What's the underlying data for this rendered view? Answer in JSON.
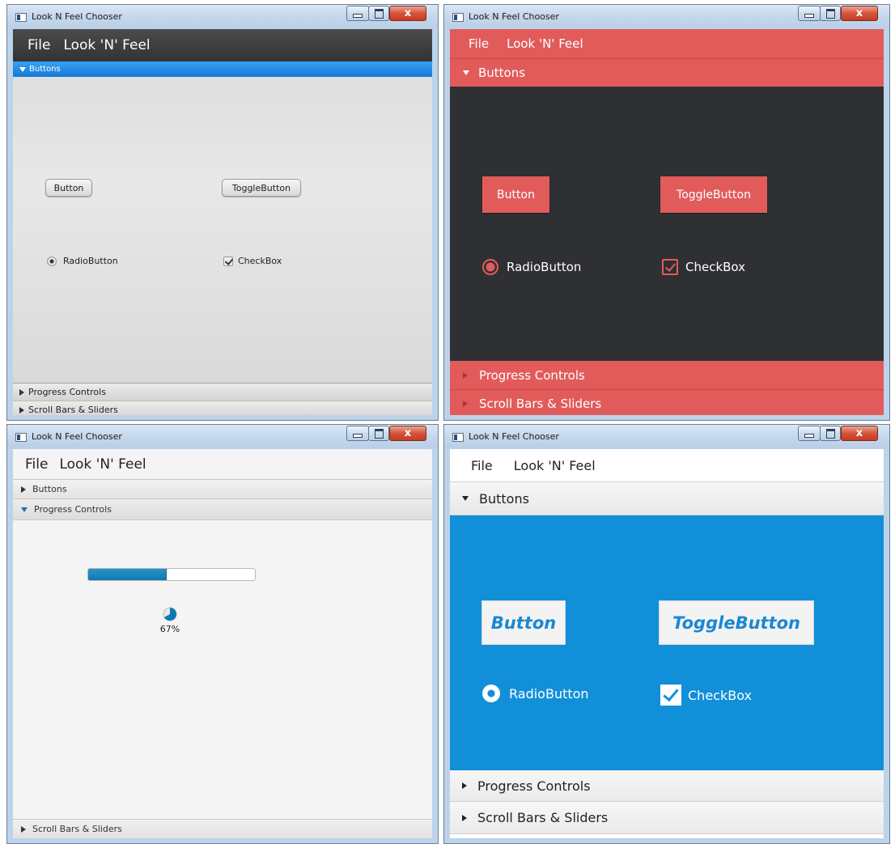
{
  "windows": [
    {
      "title": "Look N Feel Chooser",
      "theme_note": "caspian",
      "menu": [
        "File",
        "Look 'N' Feel"
      ],
      "panes": {
        "buttons": "Buttons",
        "progress": "Progress Controls",
        "scroll": "Scroll Bars & Sliders"
      },
      "expanded": "Buttons",
      "controls": {
        "button": "Button",
        "toggle": "ToggleButton",
        "radio": "RadioButton",
        "checkbox": "CheckBox"
      },
      "colors": {
        "menubar": "#333333",
        "selected_header": "#1478d6"
      }
    },
    {
      "title": "Look N Feel Chooser",
      "menu": [
        "File",
        "Look 'N' Feel"
      ],
      "panes": {
        "buttons": "Buttons",
        "progress": "Progress Controls",
        "scroll": "Scroll Bars & Sliders"
      },
      "expanded": "Buttons",
      "controls": {
        "button": "Button",
        "toggle": "ToggleButton",
        "radio": "RadioButton",
        "checkbox": "CheckBox"
      },
      "colors": {
        "accent": "#e25b5b",
        "background": "#2f3033"
      }
    },
    {
      "title": "Look N Feel Chooser",
      "menu": [
        "File",
        "Look 'N' Feel"
      ],
      "panes": {
        "buttons": "Buttons",
        "progress": "Progress Controls",
        "scroll": "Scroll Bars & Sliders"
      },
      "expanded": "Progress Controls",
      "progress": {
        "bar_fraction": 0.47,
        "indicator_fraction": 0.67,
        "indicator_label": "67%"
      },
      "colors": {
        "accent": "#0e79b1"
      }
    },
    {
      "title": "Look N Feel Chooser",
      "menu": [
        "File",
        "Look 'N' Feel"
      ],
      "panes": {
        "buttons": "Buttons",
        "progress": "Progress Controls",
        "scroll": "Scroll Bars & Sliders"
      },
      "expanded": "Buttons",
      "controls": {
        "button": "Button",
        "toggle": "ToggleButton",
        "radio": "RadioButton",
        "checkbox": "CheckBox"
      },
      "colors": {
        "accent": "#1190d9"
      }
    }
  ],
  "window_controls": {
    "close_glyph": "x"
  }
}
